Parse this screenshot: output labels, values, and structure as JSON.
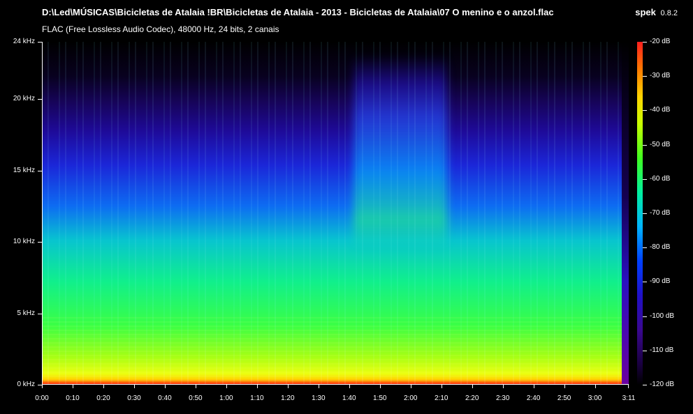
{
  "header": {
    "file_path": "D:\\Led\\MÚSICAS\\Bicicletas de Atalaia !BR\\Bicicletas de Atalaia - 2013 - Bicicletas de Atalaia\\07 O menino e o anzol.flac",
    "audio_info": "FLAC (Free Lossless Audio Codec), 48000 Hz, 24 bits, 2 canais",
    "app_name": "spek",
    "app_version": "0.8.2"
  },
  "spectrogram": {
    "frequency_axis": {
      "labels": [
        "24 kHz",
        "20 kHz",
        "15 kHz",
        "10 kHz",
        "5 kHz",
        "0 kHz"
      ],
      "values_khz": [
        24,
        20,
        15,
        10,
        5,
        0
      ],
      "max_khz": 24
    },
    "time_axis": {
      "labels": [
        "0:00",
        "0:10",
        "0:20",
        "0:30",
        "0:40",
        "0:50",
        "1:00",
        "1:10",
        "1:20",
        "1:30",
        "1:40",
        "1:50",
        "2:00",
        "2:10",
        "2:20",
        "2:30",
        "2:40",
        "2:50",
        "3:00",
        "3:11"
      ],
      "values_s": [
        0,
        10,
        20,
        30,
        40,
        50,
        60,
        70,
        80,
        90,
        100,
        110,
        120,
        130,
        140,
        150,
        160,
        170,
        180,
        191
      ],
      "duration_s": 191
    },
    "db_scale": {
      "labels": [
        "-20 dB",
        "-30 dB",
        "-40 dB",
        "-50 dB",
        "-60 dB",
        "-70 dB",
        "-80 dB",
        "-90 dB",
        "-100 dB",
        "-110 dB",
        "-120 dB"
      ],
      "values_db": [
        -20,
        -30,
        -40,
        -50,
        -60,
        -70,
        -80,
        -90,
        -100,
        -110,
        -120
      ],
      "max_db": -20,
      "min_db": -120
    }
  }
}
